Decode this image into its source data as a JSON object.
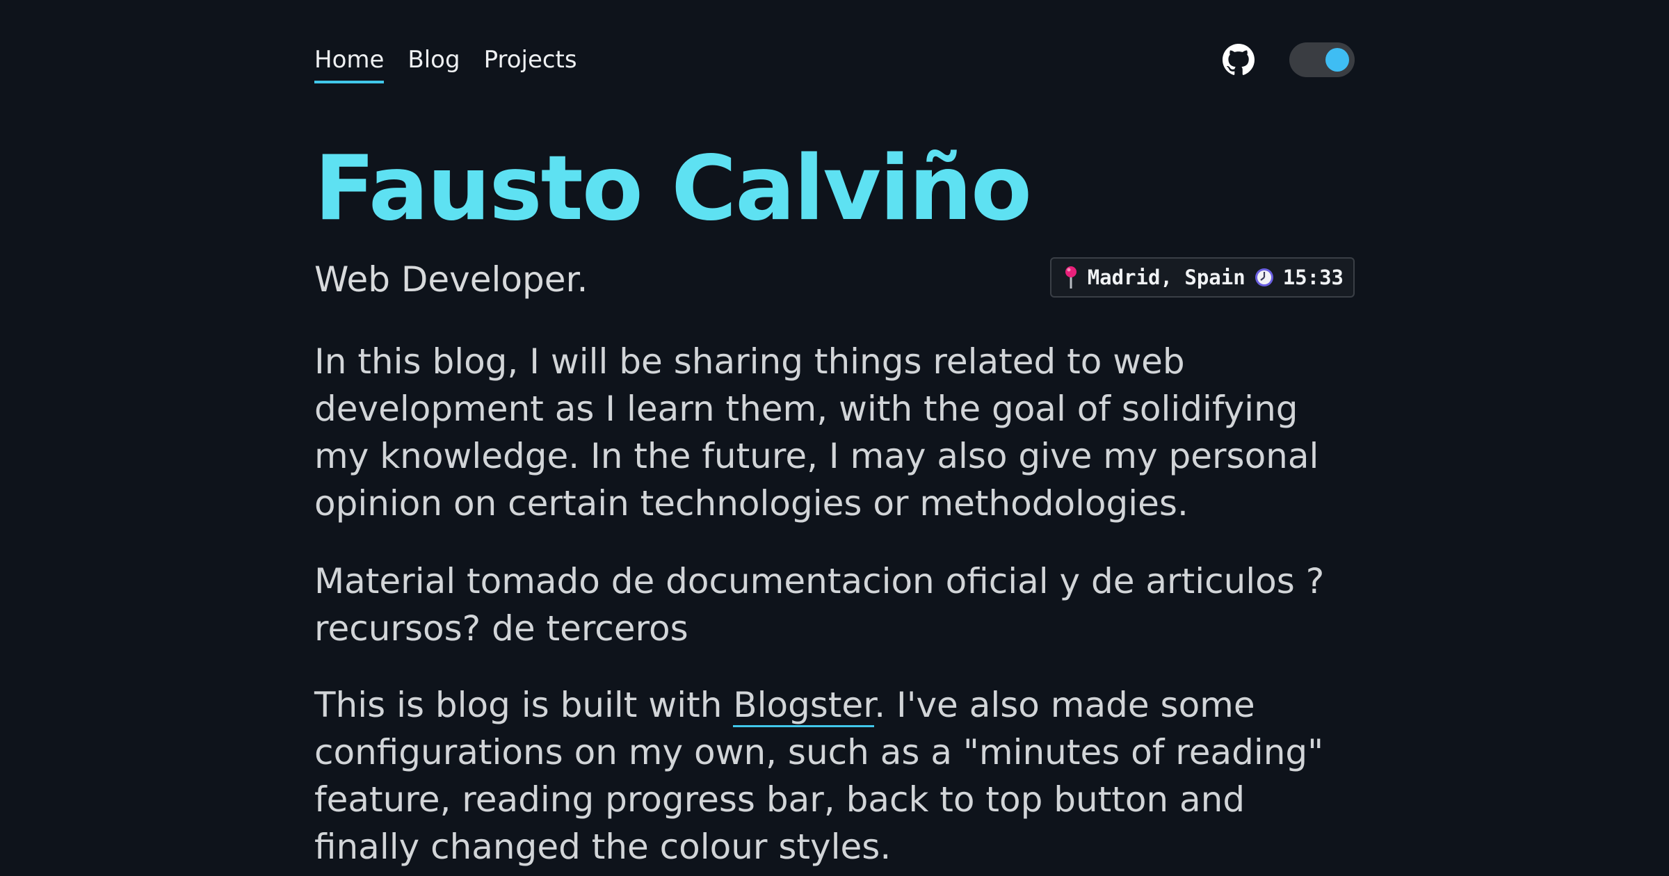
{
  "nav": {
    "links": [
      {
        "label": "Home"
      },
      {
        "label": "Blog"
      },
      {
        "label": "Projects"
      }
    ]
  },
  "header": {
    "github_icon": "github-icon",
    "theme_toggle": "theme-toggle",
    "toggle_knob_color": "#3fbdf3"
  },
  "hero": {
    "title": "Fausto Calviño",
    "subtitle": "Web Developer.",
    "location": "Madrid, Spain",
    "time": "15:33"
  },
  "content": {
    "paragraph1": "In this blog, I will be sharing things related to web development as I learn them, with the goal of solidifying my knowledge. In the future, I may also give my personal opinion on certain technologies or methodologies.",
    "paragraph2": "Material tomado de documentacion oficial y de articulos ? recursos? de terceros",
    "paragraph3_before": "This is blog is built with ",
    "paragraph3_link": "Blogster",
    "paragraph3_after": ". I've also made some configurations on my own, such as a \"minutes of reading\" feature, reading progress bar, back to top button and finally changed the colour styles."
  },
  "colors": {
    "background": "#0e131b",
    "accent": "#41c7ea",
    "title": "#5ee1f2"
  }
}
